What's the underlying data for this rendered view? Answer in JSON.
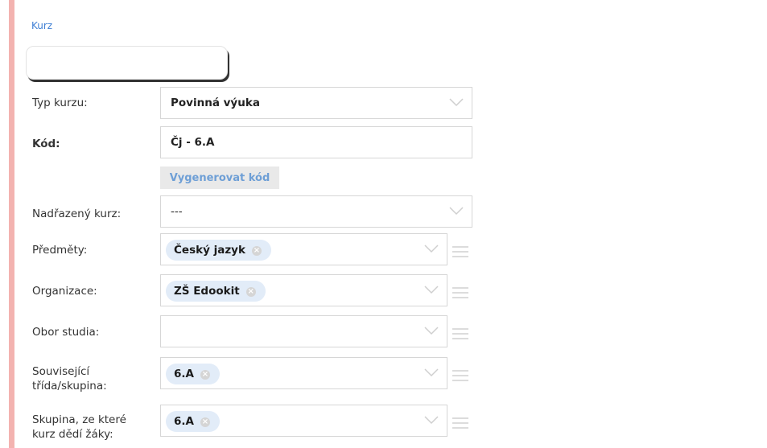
{
  "section": {
    "title": "Kurz"
  },
  "form": {
    "typ_kurzu": {
      "label": "Typ kurzu:",
      "value": "Povinná výuka"
    },
    "kod": {
      "label": "Kód:",
      "value": "Čj - 6.A"
    },
    "generate_button": "Vygenerovat kód",
    "nadrazeny_kurz": {
      "label": "Nadřazený kurz:",
      "value": "---"
    },
    "predmety": {
      "label": "Předměty:",
      "tags": [
        "Český jazyk"
      ]
    },
    "organizace": {
      "label": "Organizace:",
      "tags": [
        "ZŠ Edookit"
      ]
    },
    "obor_studia": {
      "label": "Obor studia:",
      "tags": []
    },
    "souvisejici": {
      "label_line1": "Související",
      "label_line2": "třída/skupina:",
      "tags": [
        "6.A"
      ]
    },
    "skupina_dedi": {
      "label_line1": "Skupina, ze které",
      "label_line2": "kurz dědí žáky:",
      "tags": [
        "6.A"
      ]
    }
  },
  "icons": {
    "dropdown": "chevron-down-icon",
    "remove": "close-icon",
    "reorder": "hamburger-icon"
  },
  "colors": {
    "accent_bar": "#f3b3b0",
    "link": "#3f7fd4",
    "tag_bg": "#e2ecf8",
    "button_bg": "#e9e9e9"
  }
}
